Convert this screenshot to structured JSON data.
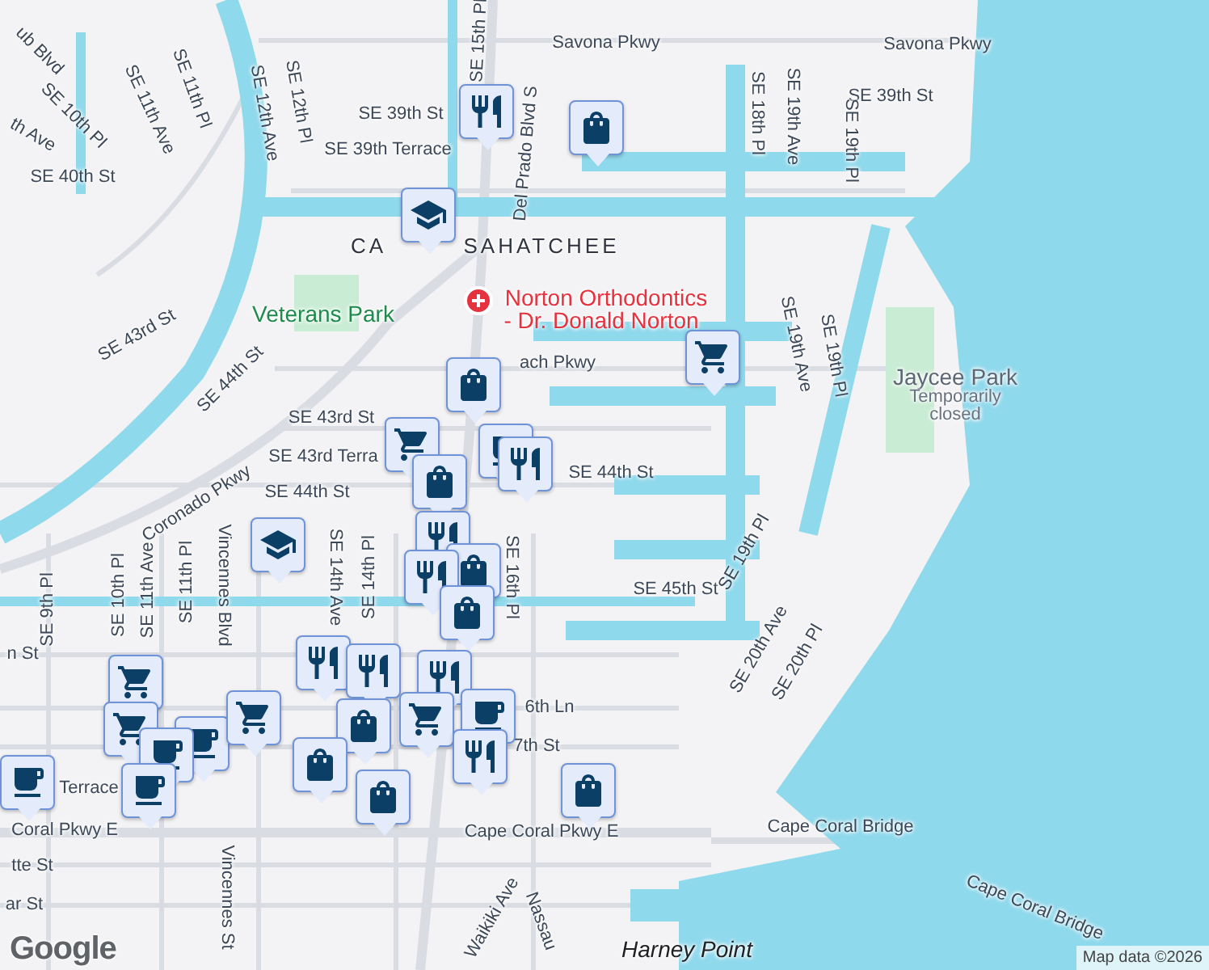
{
  "map": {
    "labels": [
      {
        "text": "ub Blvd",
        "kind": "street"
      },
      {
        "text": "SE 11th Pl",
        "kind": "street"
      },
      {
        "text": "SE 11th Ave",
        "kind": "street"
      },
      {
        "text": "SE 10th Pl",
        "kind": "street"
      },
      {
        "text": "th Ave",
        "kind": "street"
      },
      {
        "text": "SE 12th Ave",
        "kind": "street"
      },
      {
        "text": "SE 12th Pl",
        "kind": "street"
      },
      {
        "text": "SE 39th St",
        "kind": "street"
      },
      {
        "text": "SE 39th Terrace",
        "kind": "street"
      },
      {
        "text": "SE 40th St",
        "kind": "street"
      },
      {
        "text": "SE 15th Pl",
        "kind": "street"
      },
      {
        "text": "Del Prado Blvd S",
        "kind": "street"
      },
      {
        "text": "Savona Pkwy",
        "kind": "street"
      },
      {
        "text": "Savona Pkwy",
        "kind": "street"
      },
      {
        "text": "SE 39th St",
        "kind": "street"
      },
      {
        "text": "SE 18th Pl",
        "kind": "street"
      },
      {
        "text": "SE 19th Ave",
        "kind": "street"
      },
      {
        "text": "SE 19th Pl",
        "kind": "street"
      },
      {
        "text": "CA",
        "kind": "area"
      },
      {
        "text": "SAHATCHEE",
        "kind": "area"
      },
      {
        "text": "Veterans Park",
        "kind": "park"
      },
      {
        "text": "Norton Orthodontics",
        "kind": "poi"
      },
      {
        "text": "- Dr. Donald Norton",
        "kind": "poi"
      },
      {
        "text": "ach Pkwy",
        "kind": "street"
      },
      {
        "text": "SE 43rd St",
        "kind": "street"
      },
      {
        "text": "SE 44th St",
        "kind": "street"
      },
      {
        "text": "SE 43rd St",
        "kind": "street"
      },
      {
        "text": "SE 43rd Terra",
        "kind": "street"
      },
      {
        "text": "Coronado Pkwy",
        "kind": "street"
      },
      {
        "text": "SE 44th St",
        "kind": "street"
      },
      {
        "text": "SE 44th St",
        "kind": "street"
      },
      {
        "text": "SE 19th Ave",
        "kind": "street"
      },
      {
        "text": "SE 19th Pl",
        "kind": "street"
      },
      {
        "text": "Jaycee Park",
        "kind": "park-gray"
      },
      {
        "text": "Temporarily",
        "kind": "note"
      },
      {
        "text": "closed",
        "kind": "note"
      },
      {
        "text": "SE 45th St",
        "kind": "street"
      },
      {
        "text": "SE 19th Pl",
        "kind": "street"
      },
      {
        "text": "SE 20th Ave",
        "kind": "street"
      },
      {
        "text": "SE 20th Pl",
        "kind": "street"
      },
      {
        "text": "SE 9th Pl",
        "kind": "street"
      },
      {
        "text": "SE 10th Pl",
        "kind": "street"
      },
      {
        "text": "SE 11th Ave",
        "kind": "street"
      },
      {
        "text": "SE 11th Pl",
        "kind": "street"
      },
      {
        "text": "Vincennes Blvd",
        "kind": "street"
      },
      {
        "text": "SE 14th Ave",
        "kind": "street"
      },
      {
        "text": "SE 14th Pl",
        "kind": "street"
      },
      {
        "text": "SE 16th Pl",
        "kind": "street"
      },
      {
        "text": "n St",
        "kind": "street"
      },
      {
        "text": "Terrace",
        "kind": "street"
      },
      {
        "text": "6th Ln",
        "kind": "street"
      },
      {
        "text": "7th St",
        "kind": "street"
      },
      {
        "text": "Coral Pkwy E",
        "kind": "street"
      },
      {
        "text": "Cape Coral Pkwy E",
        "kind": "street"
      },
      {
        "text": "Cape Coral Bridge",
        "kind": "street"
      },
      {
        "text": "Cape Coral Bridge",
        "kind": "street"
      },
      {
        "text": "tte St",
        "kind": "street"
      },
      {
        "text": "ar St",
        "kind": "street"
      },
      {
        "text": "Vincennes St",
        "kind": "street"
      },
      {
        "text": "Waikiki Ave",
        "kind": "street"
      },
      {
        "text": "Nassau",
        "kind": "street"
      },
      {
        "text": "Harney Point",
        "kind": "place"
      }
    ],
    "pins": [
      {
        "kind": "restaurant"
      },
      {
        "kind": "shopping"
      },
      {
        "kind": "school"
      },
      {
        "kind": "shopping"
      },
      {
        "kind": "grocery"
      },
      {
        "kind": "grocery"
      },
      {
        "kind": "cafe"
      },
      {
        "kind": "restaurant"
      },
      {
        "kind": "shopping"
      },
      {
        "kind": "restaurant"
      },
      {
        "kind": "shopping"
      },
      {
        "kind": "restaurant"
      },
      {
        "kind": "shopping"
      },
      {
        "kind": "restaurant"
      },
      {
        "kind": "restaurant"
      },
      {
        "kind": "school"
      },
      {
        "kind": "grocery"
      },
      {
        "kind": "grocery"
      },
      {
        "kind": "cafe"
      },
      {
        "kind": "cafe"
      },
      {
        "kind": "grocery"
      },
      {
        "kind": "cafe"
      },
      {
        "kind": "cafe"
      },
      {
        "kind": "restaurant"
      },
      {
        "kind": "shopping"
      },
      {
        "kind": "grocery"
      },
      {
        "kind": "cafe"
      },
      {
        "kind": "restaurant"
      },
      {
        "kind": "shopping"
      },
      {
        "kind": "shopping"
      },
      {
        "kind": "shopping"
      }
    ],
    "logo": "Google",
    "attribution": "Map data ©2026"
  }
}
